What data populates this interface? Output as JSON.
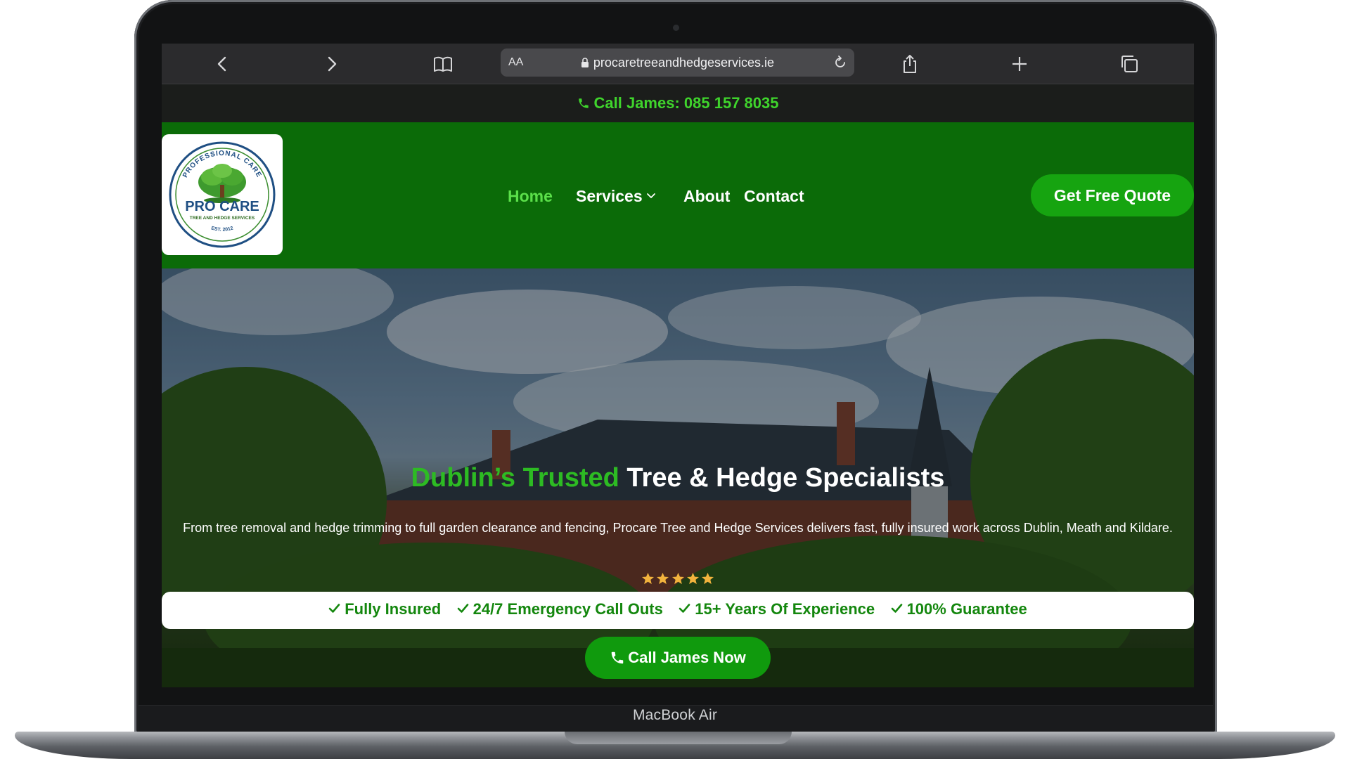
{
  "device": {
    "label": "MacBook Air"
  },
  "browser": {
    "address_prefix": "AA",
    "url": "procaretreeandhedgeservices.ie",
    "icons": [
      "back-icon",
      "forward-icon",
      "bookmarks-icon",
      "lock-icon",
      "reload-icon",
      "share-icon",
      "new-tab-icon",
      "tabs-overview-icon"
    ]
  },
  "site": {
    "top_strip": {
      "call_text": "Call James: 085 157 8035",
      "icon": "phone-icon"
    },
    "logo": {
      "arc_text": "PROFESSIONAL CARE",
      "brand": "PRO CARE",
      "tagline": "TREE AND HEDGE SERVICES",
      "established": "EST. 2012"
    },
    "nav": {
      "items": [
        {
          "label": "Home",
          "active": true
        },
        {
          "label": "Services",
          "has_dropdown": true
        },
        {
          "label": "About"
        },
        {
          "label": "Contact"
        }
      ],
      "cta": "Get Free Quote"
    },
    "hero": {
      "title_accent": "Dublin’s Trusted",
      "title_rest": "Tree & Hedge Specialists",
      "description": "From tree removal and hedge trimming to full garden clearance and fencing, Procare Tree and Hedge Services delivers fast, fully insured work across Dublin, Meath and Kildare.",
      "rating_stars": 5,
      "trust_items": [
        "Fully Insured",
        "24/7 Emergency Call Outs",
        "15+ Years Of Experience",
        "100% Guarantee"
      ],
      "call_button": "Call James Now"
    }
  },
  "colors": {
    "nav_green": "#0b6b08",
    "accent_green": "#2dbb23",
    "button_green": "#16a410",
    "star_gold": "#f2b33d",
    "trust_text": "#14870e"
  }
}
